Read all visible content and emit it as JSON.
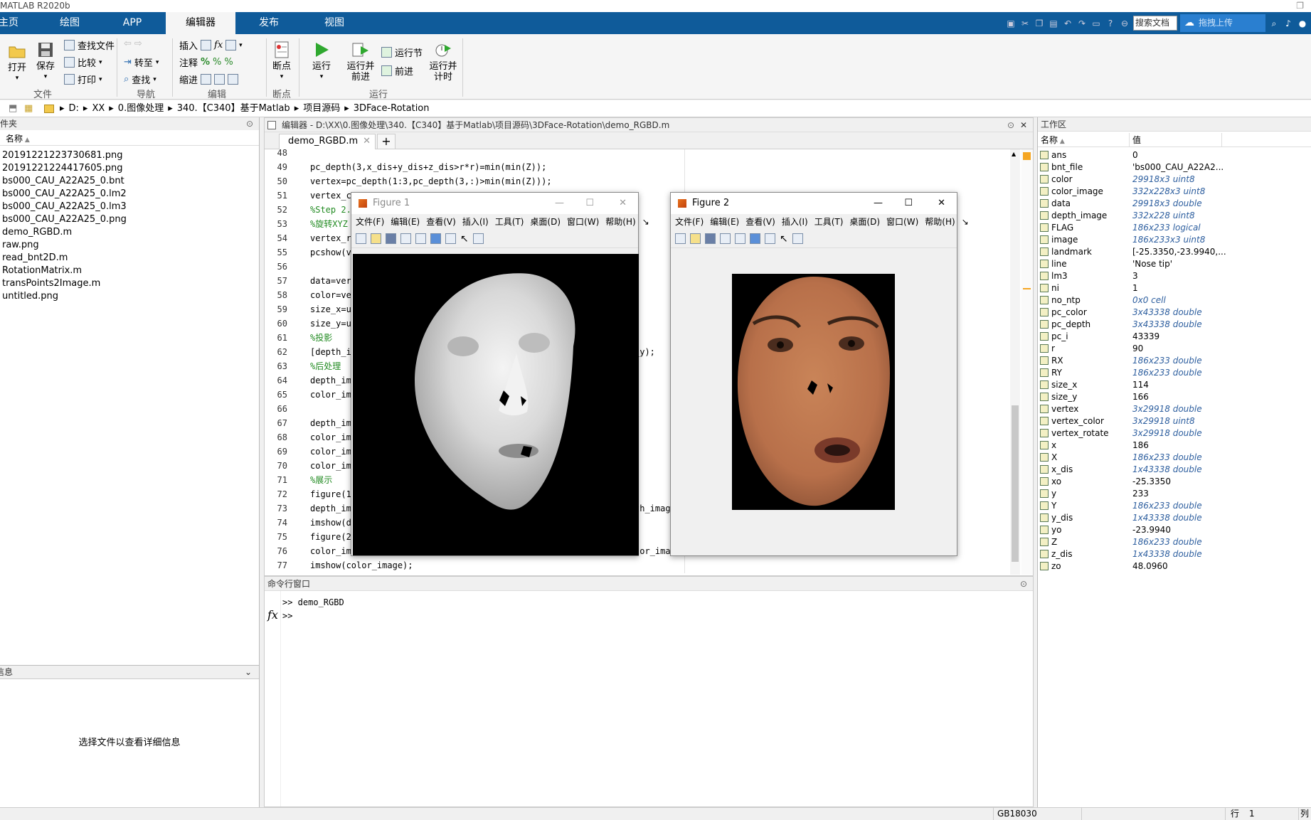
{
  "app": {
    "title": "MATLAB R2020b"
  },
  "tabs": [
    "主页",
    "绘图",
    "APP",
    "编辑器",
    "发布",
    "视图"
  ],
  "active_tab": "编辑器",
  "quick_access": {
    "search_placeholder": "搜索文档",
    "upload_label": "拖拽上传"
  },
  "ribbon": {
    "file": {
      "open": "打开",
      "save": "保存",
      "find_files": "查找文件",
      "compare": "比较",
      "print": "打印",
      "group": "文件"
    },
    "nav": {
      "goto": "转至",
      "find": "查找",
      "group": "导航"
    },
    "edit": {
      "insert": "插入",
      "comment": "注释",
      "indent": "缩进",
      "fx": "fx",
      "pct": "%",
      "group": "编辑"
    },
    "breakpoints": {
      "label": "断点",
      "group": "断点"
    },
    "run": {
      "run": "运行",
      "run_advance_1": "运行并",
      "run_advance_2": "前进",
      "run_section": "运行节",
      "advance": "前进",
      "run_time_1": "运行并",
      "run_time_2": "计时",
      "group": "运行"
    }
  },
  "address": {
    "drive": "D:",
    "parts": [
      "XX",
      "0.图像处理",
      "340.【C340】基于Matlab",
      "项目源码",
      "3DFace-Rotation"
    ]
  },
  "left_pane": {
    "title": "文件夹",
    "col_name": "名称",
    "files": [
      "20191221223730681.png",
      "20191221224417605.png",
      "bs000_CAU_A22A25_0.bnt",
      "bs000_CAU_A22A25_0.lm2",
      "bs000_CAU_A22A25_0.lm3",
      "bs000_CAU_A22A25_0.png",
      "demo_RGBD.m",
      "raw.png",
      "read_bnt2D.m",
      "RotationMatrix.m",
      "transPoints2Image.m",
      "untitled.png"
    ],
    "details_title": "信息",
    "details_msg": "选择文件以查看详细信息"
  },
  "editor": {
    "title": "编辑器 - D:\\XX\\0.图像处理\\340.【C340】基于Matlab\\项目源码\\3DFace-Rotation\\demo_RGBD.m",
    "tab": "demo_RGBD.m",
    "lines": [
      {
        "n": "48",
        "t": ""
      },
      {
        "n": "49",
        "t": "pc_depth(3,x_dis+y_dis+z_dis>r*r)=min(min(Z));"
      },
      {
        "n": "50",
        "t": "vertex=pc_depth(1:3,pc_depth(3,:)>min(min(Z)));"
      },
      {
        "n": "51",
        "t": "vertex_co"
      },
      {
        "n": "52",
        "t": "%Step 2.",
        "c": true
      },
      {
        "n": "53",
        "t": "%旋转XYZ",
        "c": true
      },
      {
        "n": "54",
        "t": "vertex_r"
      },
      {
        "n": "55",
        "t": "pcshow(v"
      },
      {
        "n": "56",
        "t": ""
      },
      {
        "n": "57",
        "t": "data=vert"
      },
      {
        "n": "58",
        "t": "color=ver"
      },
      {
        "n": "59",
        "t": "size_x=u"
      },
      {
        "n": "60",
        "t": "size_y=u"
      },
      {
        "n": "61",
        "t": "%投影",
        "c": true
      },
      {
        "n": "62",
        "t": "[depth_i"
      },
      {
        "n": "63",
        "t": "%后处理",
        "c": true
      },
      {
        "n": "64",
        "t": "depth_ima"
      },
      {
        "n": "65",
        "t": "color_ima"
      },
      {
        "n": "66",
        "t": ""
      },
      {
        "n": "67",
        "t": "depth_ima"
      },
      {
        "n": "68",
        "t": "color_ima"
      },
      {
        "n": "69",
        "t": "color_ima"
      },
      {
        "n": "70",
        "t": "color_ima"
      },
      {
        "n": "71",
        "t": "%展示",
        "c": true
      },
      {
        "n": "72",
        "t": "figure(1)"
      },
      {
        "n": "73",
        "t": "depth_ima"
      },
      {
        "n": "74",
        "t": "imshow(de"
      },
      {
        "n": "75",
        "t": "figure(2)"
      },
      {
        "n": "76",
        "t": "color_ima"
      },
      {
        "n": "77",
        "t": "imshow(color_image);"
      }
    ],
    "tails": {
      "l62": "_y);",
      "l73": "th_imag",
      "l76": "lor_imag"
    }
  },
  "cmd": {
    "title": "命令行窗口",
    "line1": ">> demo_RGBD",
    "prompt": ">>",
    "fx": "fx"
  },
  "workspace": {
    "title": "工作区",
    "col_name": "名称",
    "col_value": "值",
    "vars": [
      {
        "name": "ans",
        "value": "0",
        "it": false
      },
      {
        "name": "bnt_file",
        "value": "'bs000_CAU_A22A2...",
        "it": false
      },
      {
        "name": "color",
        "value": "29918x3 uint8",
        "it": true
      },
      {
        "name": "color_image",
        "value": "332x228x3 uint8",
        "it": true
      },
      {
        "name": "data",
        "value": "29918x3 double",
        "it": true
      },
      {
        "name": "depth_image",
        "value": "332x228 uint8",
        "it": true
      },
      {
        "name": "FLAG",
        "value": "186x233 logical",
        "it": true
      },
      {
        "name": "image",
        "value": "186x233x3 uint8",
        "it": true
      },
      {
        "name": "landmark",
        "value": "[-25.3350,-23.9940,...",
        "it": false
      },
      {
        "name": "line",
        "value": "'Nose tip'",
        "it": false
      },
      {
        "name": "lm3",
        "value": "3",
        "it": false
      },
      {
        "name": "ni",
        "value": "1",
        "it": false
      },
      {
        "name": "no_ntp",
        "value": "0x0 cell",
        "it": true
      },
      {
        "name": "pc_color",
        "value": "3x43338 double",
        "it": true
      },
      {
        "name": "pc_depth",
        "value": "3x43338 double",
        "it": true
      },
      {
        "name": "pc_i",
        "value": "43339",
        "it": false
      },
      {
        "name": "r",
        "value": "90",
        "it": false
      },
      {
        "name": "RX",
        "value": "186x233 double",
        "it": true
      },
      {
        "name": "RY",
        "value": "186x233 double",
        "it": true
      },
      {
        "name": "size_x",
        "value": "114",
        "it": false
      },
      {
        "name": "size_y",
        "value": "166",
        "it": false
      },
      {
        "name": "vertex",
        "value": "3x29918 double",
        "it": true
      },
      {
        "name": "vertex_color",
        "value": "3x29918 uint8",
        "it": true
      },
      {
        "name": "vertex_rotate",
        "value": "3x29918 double",
        "it": true
      },
      {
        "name": "x",
        "value": "186",
        "it": false
      },
      {
        "name": "X",
        "value": "186x233 double",
        "it": true
      },
      {
        "name": "x_dis",
        "value": "1x43338 double",
        "it": true
      },
      {
        "name": "xo",
        "value": "-25.3350",
        "it": false
      },
      {
        "name": "y",
        "value": "233",
        "it": false
      },
      {
        "name": "Y",
        "value": "186x233 double",
        "it": true
      },
      {
        "name": "y_dis",
        "value": "1x43338 double",
        "it": true
      },
      {
        "name": "yo",
        "value": "-23.9940",
        "it": false
      },
      {
        "name": "Z",
        "value": "186x233 double",
        "it": true
      },
      {
        "name": "z_dis",
        "value": "1x43338 double",
        "it": true
      },
      {
        "name": "zo",
        "value": "48.0960",
        "it": false
      }
    ]
  },
  "fig1": {
    "title": "Figure 1",
    "menu": [
      "文件(F)",
      "编辑(E)",
      "查看(V)",
      "插入(I)",
      "工具(T)",
      "桌面(D)",
      "窗口(W)",
      "帮助(H)"
    ]
  },
  "fig2": {
    "title": "Figure 2",
    "menu": [
      "文件(F)",
      "编辑(E)",
      "查看(V)",
      "插入(I)",
      "工具(T)",
      "桌面(D)",
      "窗口(W)",
      "帮助(H)"
    ]
  },
  "status": {
    "encoding": "GB18030",
    "row_label": "行",
    "row": "1",
    "col_label": "列"
  }
}
